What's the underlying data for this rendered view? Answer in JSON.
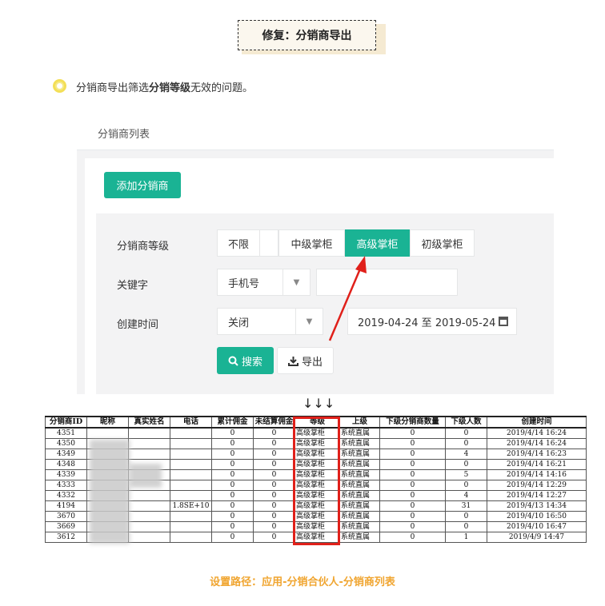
{
  "title": "修复：分销商导出",
  "description": {
    "pre": "分销商导出筛选",
    "bold": "分销等级",
    "post": "无效的问题。"
  },
  "panel": {
    "heading": "分销商列表",
    "add_button": "添加分销商",
    "level_label": "分销商等级",
    "levels": [
      "不限",
      "中级掌柜",
      "高级掌柜",
      "初级掌柜"
    ],
    "selected_level": "高级掌柜",
    "keyword_label": "关键字",
    "keyword_select": "手机号",
    "keyword_value": "",
    "time_label": "创建时间",
    "time_select": "关闭",
    "date_range": "2019-04-24 至 2019-05-24",
    "search_button": "搜索",
    "export_button": "导出"
  },
  "arrows": "↓↓↓",
  "sheet": {
    "headers": [
      "分销商ID",
      "昵称",
      "真实姓名",
      "电话",
      "累计佣金",
      "未结算佣金",
      "等级",
      "上级",
      "下级分销商数量",
      "下级人数",
      "创建时间"
    ],
    "rows": [
      [
        "4351",
        "",
        "",
        "",
        "0",
        "0",
        "高级掌柜",
        "系统直属",
        "0",
        "0",
        "2019/4/14 16:24"
      ],
      [
        "4350",
        "",
        "",
        "",
        "0",
        "0",
        "高级掌柜",
        "系统直属",
        "0",
        "0",
        "2019/4/14 16:24"
      ],
      [
        "4349",
        "",
        "",
        "",
        "0",
        "0",
        "高级掌柜",
        "系统直属",
        "0",
        "4",
        "2019/4/14 16:23"
      ],
      [
        "4348",
        "",
        "",
        "",
        "0",
        "0",
        "高级掌柜",
        "系统直属",
        "0",
        "0",
        "2019/4/14 16:21"
      ],
      [
        "4339",
        "",
        "",
        "",
        "0",
        "0",
        "高级掌柜",
        "系统直属",
        "0",
        "5",
        "2019/4/14 14:16"
      ],
      [
        "4333",
        "",
        "",
        "",
        "0",
        "0",
        "高级掌柜",
        "系统直属",
        "0",
        "0",
        "2019/4/14 12:29"
      ],
      [
        "4332",
        "",
        "",
        "",
        "0",
        "0",
        "高级掌柜",
        "系统直属",
        "0",
        "4",
        "2019/4/14 12:27"
      ],
      [
        "4194",
        "",
        "",
        "1.8SE+10",
        "0",
        "0",
        "高级掌柜",
        "系统直属",
        "0",
        "31",
        "2019/4/13 14:34"
      ],
      [
        "3670",
        "",
        "",
        "",
        "0",
        "0",
        "高级掌柜",
        "系统直属",
        "0",
        "0",
        "2019/4/10 16:50"
      ],
      [
        "3669",
        "",
        "",
        "",
        "0",
        "0",
        "高级掌柜",
        "系统直属",
        "0",
        "0",
        "2019/4/10 16:47"
      ],
      [
        "3612",
        "",
        "",
        "",
        "0",
        "0",
        "高级掌柜",
        "系统直属",
        "0",
        "1",
        "2019/4/9 14:47"
      ]
    ]
  },
  "settings_path": "设置路径：应用-分销合伙人-分销商列表",
  "colors": {
    "accent": "#1ab394",
    "highlight": "#e0201a",
    "path_text": "#f0a530"
  }
}
